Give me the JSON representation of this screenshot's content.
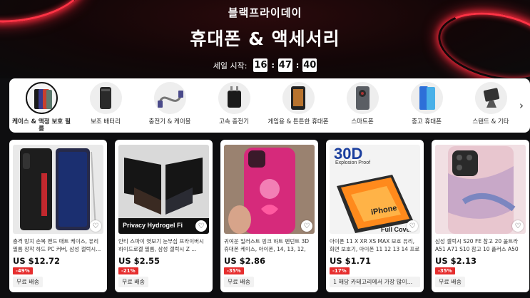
{
  "hero": {
    "subtitle": "블랙프라이데이",
    "title": "휴대폰 & 액세서리",
    "countdown_label": "세일 시작:",
    "hours": "16",
    "minutes": "47",
    "seconds": "40",
    "sep1": ":",
    "sep2": ":"
  },
  "categories": [
    {
      "label": "케이스 & 액정 보호 필름",
      "icon": "phone-case-icon",
      "active": true
    },
    {
      "label": "보조 배터리",
      "icon": "power-bank-icon"
    },
    {
      "label": "충전기 & 케이블",
      "icon": "cable-icon"
    },
    {
      "label": "고속 충전기",
      "icon": "charger-icon"
    },
    {
      "label": "게임용 & 튼튼한 휴대폰",
      "icon": "rugged-phone-icon"
    },
    {
      "label": "스마트폰",
      "icon": "smartphone-icon"
    },
    {
      "label": "중고 휴대폰",
      "icon": "used-phone-icon"
    },
    {
      "label": "스탠드 & 기타",
      "icon": "stand-icon"
    }
  ],
  "next_arrow": "›",
  "products": [
    {
      "title": "충격 방지 손목 밴드 매트 케이스, 유리 필름 장착 하드 PC 커버, 삼성 갤럭시...",
      "price": "US $12.72",
      "discount": "-49%",
      "shipping": "무료 배송"
    },
    {
      "title": "안티 스파이 엿보기 눈부심 프라이버시 하이드로겔 필름, 삼성 갤럭시 Z ...",
      "price": "US $2.55",
      "discount": "-21%",
      "shipping": "무료 배송",
      "image_caption": "Privacy Hydrogel Fi"
    },
    {
      "title": "귀여운 일러스트 핑크 하트 펜던트 3D 휴대폰 케이스, 아이폰, 14, 13, 12, 1...",
      "price": "US $2.86",
      "discount": "-35%",
      "shipping": "무료 배송"
    },
    {
      "title": "아이폰 11 X XR XS MAX 보호 유리, 화면 보호기, 아이폰 11 12 13 14 프로 ...",
      "price": "US $1.71",
      "discount": "-17%",
      "shipping": "1 해당 카테고리에서 가장 많이...",
      "image_top": "30D",
      "image_sub": "Explosion Proof",
      "image_mid": "iPhone",
      "image_bottom": "Full Cover"
    },
    {
      "title": "삼성 갤럭시 S20 FE 참고 20 울트라 A51 A71 S10 참고 10 플러스 A50 A1...",
      "price": "US $2.13",
      "discount": "-35%",
      "shipping": "무료 배송"
    }
  ],
  "colors": {
    "accent": "#e62e2e",
    "neon": "#ff2a3d",
    "background": "#0e0e10"
  }
}
